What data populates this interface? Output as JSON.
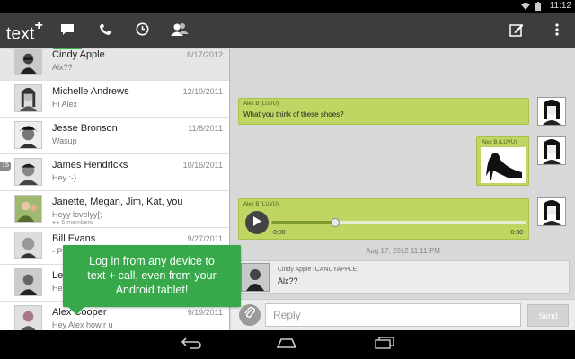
{
  "status_bar": {
    "time": "11:12"
  },
  "app": {
    "logo_text": "text",
    "logo_plus": "+"
  },
  "tabs": [
    {
      "name": "messages",
      "icon": "chat-bubble-icon",
      "active": true
    },
    {
      "name": "calls",
      "icon": "phone-icon",
      "active": false
    },
    {
      "name": "history",
      "icon": "clock-icon",
      "active": false
    },
    {
      "name": "contacts",
      "icon": "contacts-icon",
      "active": false
    }
  ],
  "actions": [
    {
      "name": "compose",
      "icon": "compose-icon"
    },
    {
      "name": "overflow",
      "icon": "overflow-menu-icon"
    }
  ],
  "conversations": [
    {
      "name": "Cindy Apple",
      "date": "8/17/2012",
      "preview": "Alx??",
      "selected": true
    },
    {
      "name": "Michelle Andrews",
      "date": "12/19/2011",
      "preview": "Hi Alex"
    },
    {
      "name": "Jesse Bronson",
      "date": "11/8/2011",
      "preview": "Wasup"
    },
    {
      "name": "James Hendricks",
      "date": "10/16/2011",
      "preview": "Hey :-)"
    },
    {
      "name": "Janette, Megan, Jim, Kat, you",
      "date": "",
      "preview": "Heyy lovelyy[;",
      "members": "5 members"
    },
    {
      "name": "Bill Evans",
      "date": "9/27/2011",
      "preview": "- P"
    },
    {
      "name": "Len",
      "date": "",
      "preview": "He"
    },
    {
      "name": "Alex Cooper",
      "date": "9/19/2011",
      "preview": "Hey Alex how r u"
    }
  ],
  "edge_badge": "15",
  "chat": {
    "messages": [
      {
        "sender": "Alex B (LUVU)",
        "text": "What you think of these shoes?"
      },
      {
        "sender": "Alex B (LUVU)",
        "text": ""
      },
      {
        "sender": "Alex B (LUVU)",
        "audio_start": "0:00",
        "audio_end": "0:30",
        "audio_progress": 0.25
      }
    ],
    "time_separator": "Aug 17, 2012 11:11 PM",
    "incoming": {
      "sender": "Cindy Apple (CANDYAPPLE)",
      "text": "Alx??"
    }
  },
  "reply": {
    "placeholder": "Reply",
    "send_label": "Send"
  },
  "tooltip": {
    "line1": "Log in from any device to",
    "line2": "text + call, even from your",
    "line3": "Android tablet!"
  },
  "colors": {
    "accent": "#36b34a",
    "bubble": "#bfd663",
    "actionbar": "#3c3d3f"
  }
}
